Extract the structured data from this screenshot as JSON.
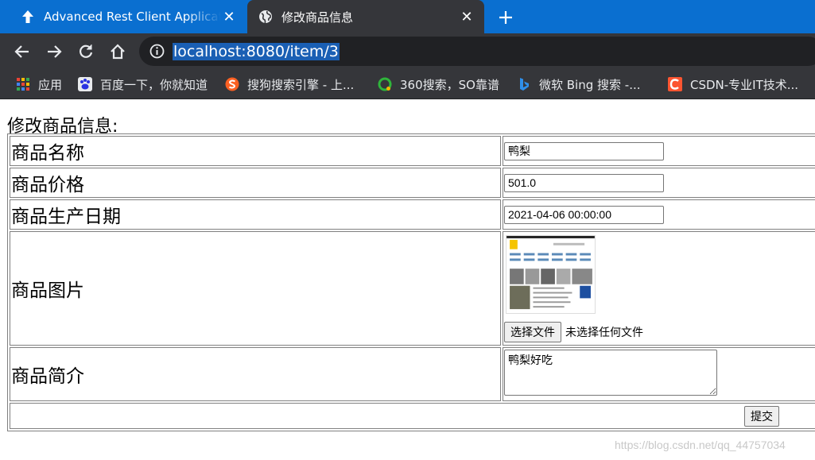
{
  "tabs": [
    {
      "title": "Advanced Rest Client Application",
      "active": false
    },
    {
      "title": "修改商品信息",
      "active": true
    }
  ],
  "address_bar": {
    "url": "localhost:8080/item/3"
  },
  "bookmarks": [
    {
      "label": "应用",
      "icon": "apps-grid-icon"
    },
    {
      "label": "百度一下，你就知道",
      "icon": "baidu-paw-icon"
    },
    {
      "label": "搜狗搜索引擎 - 上...",
      "icon": "sogou-icon"
    },
    {
      "label": "360搜索，SO靠谱",
      "icon": "so360-icon"
    },
    {
      "label": "微软 Bing 搜索 -...",
      "icon": "bing-icon"
    },
    {
      "label": "CSDN-专业IT技术...",
      "icon": "csdn-icon"
    }
  ],
  "page": {
    "heading": "修改商品信息:",
    "fields": {
      "name_label": "商品名称",
      "name_value": "鸭梨",
      "price_label": "商品价格",
      "price_value": "501.0",
      "date_label": "商品生产日期",
      "date_value": "2021-04-06 00:00:00",
      "image_label": "商品图片",
      "file_button": "选择文件",
      "file_status": "未选择任何文件",
      "desc_label": "商品简介",
      "desc_value": "鸭梨好吃"
    },
    "submit_label": "提交"
  },
  "watermark": "https://blog.csdn.net/qq_44757034",
  "colors": {
    "tabstrip": "#0a6fd0",
    "toolbar": "#35363a",
    "url_highlight": "#1a5fb4"
  }
}
